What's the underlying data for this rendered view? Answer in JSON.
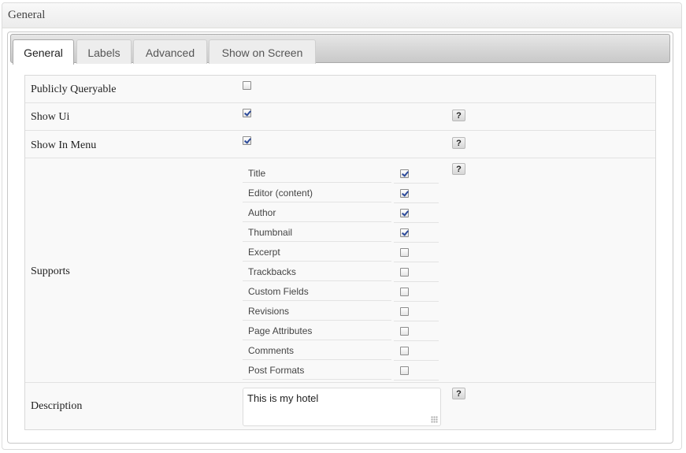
{
  "panel": {
    "title": "General"
  },
  "tabs": [
    {
      "label": "General",
      "active": true
    },
    {
      "label": "Labels",
      "active": false
    },
    {
      "label": "Advanced",
      "active": false
    },
    {
      "label": "Show on Screen",
      "active": false
    }
  ],
  "fields": {
    "publicly_queryable": {
      "label": "Publicly Queryable",
      "checked": false
    },
    "show_ui": {
      "label": "Show Ui",
      "checked": true,
      "help": "?"
    },
    "show_in_menu": {
      "label": "Show In Menu",
      "checked": true,
      "help": "?"
    },
    "supports": {
      "label": "Supports",
      "help": "?",
      "items": [
        {
          "label": "Title",
          "checked": true
        },
        {
          "label": "Editor (content)",
          "checked": true
        },
        {
          "label": "Author",
          "checked": true
        },
        {
          "label": "Thumbnail",
          "checked": true
        },
        {
          "label": "Excerpt",
          "checked": false
        },
        {
          "label": "Trackbacks",
          "checked": false
        },
        {
          "label": "Custom Fields",
          "checked": false
        },
        {
          "label": "Revisions",
          "checked": false
        },
        {
          "label": "Page Attributes",
          "checked": false
        },
        {
          "label": "Comments",
          "checked": false
        },
        {
          "label": "Post Formats",
          "checked": false
        }
      ]
    },
    "description": {
      "label": "Description",
      "value": "This is my hotel",
      "help": "?"
    }
  }
}
